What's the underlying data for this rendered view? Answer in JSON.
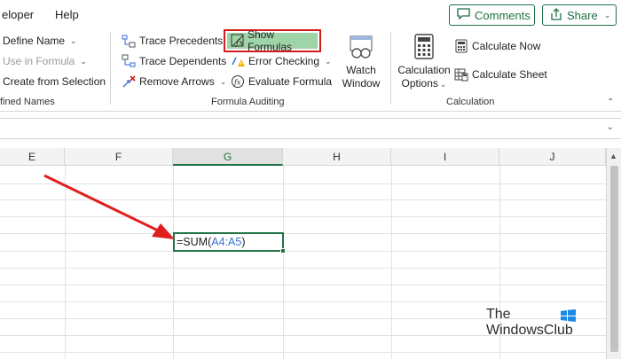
{
  "tabs": {
    "developer": "eloper",
    "help": "Help"
  },
  "top_buttons": {
    "comments": "Comments",
    "share": "Share"
  },
  "defined_names": {
    "define_name": "Define Name",
    "use_in_formula": "Use in Formula",
    "create_from_selection": "Create from Selection",
    "group_label": "fined Names"
  },
  "formula_auditing": {
    "trace_precedents": "Trace Precedents",
    "trace_dependents": "Trace Dependents",
    "remove_arrows": "Remove Arrows",
    "show_formulas": "Show Formulas",
    "error_checking": "Error Checking",
    "evaluate_formula": "Evaluate Formula",
    "watch_window_l1": "Watch",
    "watch_window_l2": "Window",
    "group_label": "Formula Auditing"
  },
  "calculation": {
    "options_l1": "Calculation",
    "options_l2": "Options",
    "calculate_now": "Calculate Now",
    "calculate_sheet": "Calculate Sheet",
    "group_label": "Calculation"
  },
  "columns": [
    "E",
    "F",
    "G",
    "H",
    "I",
    "J"
  ],
  "selected_column": "G",
  "active_cell": {
    "prefix": "=SUM(",
    "ref": "A4:A5",
    "suffix": ")"
  },
  "watermark": {
    "line1": "The",
    "line2": "WindowsClub"
  },
  "colors": {
    "accent": "#217346",
    "highlight_border": "#d21d1d",
    "highlight_fill": "#9fd3a8",
    "arrow": "#e02020"
  }
}
